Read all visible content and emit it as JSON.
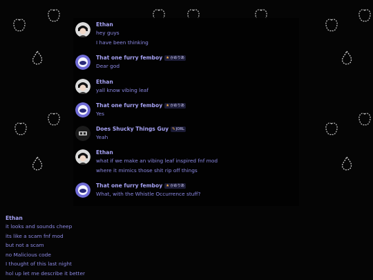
{
  "messages": [
    {
      "author": "Ethan",
      "avatar": "ethan-avatar-icon",
      "tag": "",
      "timestamp": "",
      "lines": [
        "hey guys",
        "I have been thinking"
      ]
    },
    {
      "author": "That one furry femboy",
      "avatar": "femboy-avatar-icon",
      "tag": "かめりあ",
      "timestamp": "",
      "lines": [
        "Dear god"
      ]
    },
    {
      "author": "Ethan",
      "avatar": "ethan-avatar-icon",
      "tag": "",
      "timestamp": "",
      "lines": [
        "yall know vibing leaf"
      ]
    },
    {
      "author": "That one furry femboy",
      "avatar": "femboy-avatar-icon",
      "tag": "かめりあ",
      "timestamp": "",
      "lines": [
        "Yes"
      ]
    },
    {
      "author": "Does Shucky Things Guy",
      "avatar": "shucky-avatar-icon",
      "tag": "JORL",
      "timestamp": "",
      "lines": [
        "Yeah"
      ]
    },
    {
      "author": "Ethan",
      "avatar": "ethan-avatar-icon",
      "tag": "",
      "timestamp": "",
      "lines": [
        "what if we make an vibing leaf inspired fnf mod",
        "where it mimics those shit rip off things"
      ]
    },
    {
      "author": "That one furry femboy",
      "avatar": "femboy-avatar-icon",
      "tag": "かめりあ",
      "timestamp": "",
      "lines": [
        "What, with the Whistle Occurrence stuff?"
      ]
    }
  ],
  "bottom": {
    "author": "Ethan",
    "timestamp": "",
    "lines": [
      "it looks and sounds cheep",
      "its like a scam fnf mod",
      "but not a scam",
      "no Malicious code",
      "I thought of this last night",
      "hol up let me describe it better"
    ],
    "edited_marker": ""
  },
  "colors": {
    "author": "#a7a3f5",
    "text": "#8d8ae6",
    "timestamp": "#2f2f78",
    "background": "#000000"
  }
}
